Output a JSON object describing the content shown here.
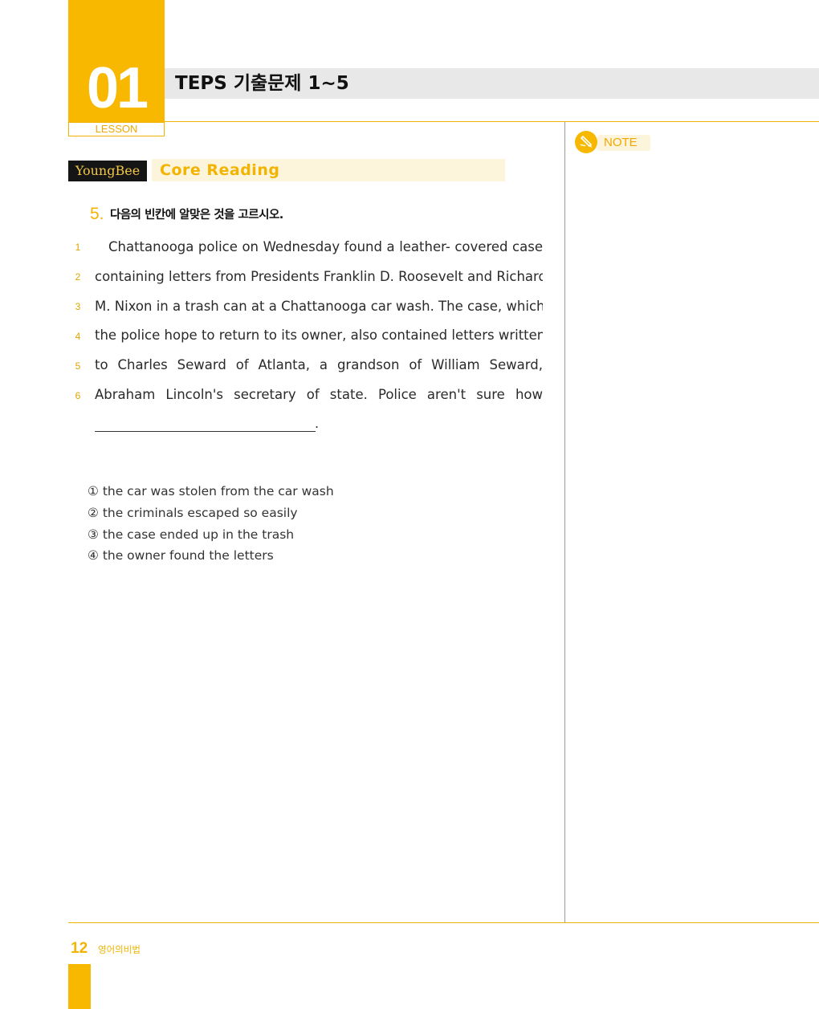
{
  "header": {
    "lesson_number": "01",
    "lesson_label": "LESSON",
    "title": "TEPS 기출문제 1~5"
  },
  "section": {
    "badge": "YoungBee",
    "title": "Core Reading"
  },
  "question": {
    "number": "5.",
    "instruction": "다음의 빈칸에 알맞은 것을 고르시오."
  },
  "passage": {
    "lines": [
      {
        "num": "1",
        "text": "Chattanooga police on Wednesday found a leather- covered case"
      },
      {
        "num": "2",
        "text": "containing letters from Presidents Franklin D. Roosevelt and Richard"
      },
      {
        "num": "3",
        "text": "M. Nixon in a trash can at a Chattanooga car wash. The case, which"
      },
      {
        "num": "4",
        "text": "the police hope to return to its owner, also contained letters written"
      },
      {
        "num": "5",
        "text": "to Charles Seward of Atlanta, a grandson of William Seward,"
      },
      {
        "num": "6",
        "text": "Abraham Lincoln's secretary of state. Police aren't sure how"
      }
    ],
    "blank_end": "."
  },
  "options": [
    "① the car was stolen from the car wash",
    "② the criminals escaped so easily",
    "③ the case ended up in the trash",
    "④ the owner found the letters"
  ],
  "note": {
    "label": "NOTE",
    "icon": "pencil-icon"
  },
  "footer": {
    "page_number": "12",
    "book_title": "영어의비법"
  },
  "colors": {
    "accent": "#f9b800",
    "accent_light": "#fdf4dc",
    "title_bar": "#e8e8e8",
    "badge_bg": "#151515"
  }
}
